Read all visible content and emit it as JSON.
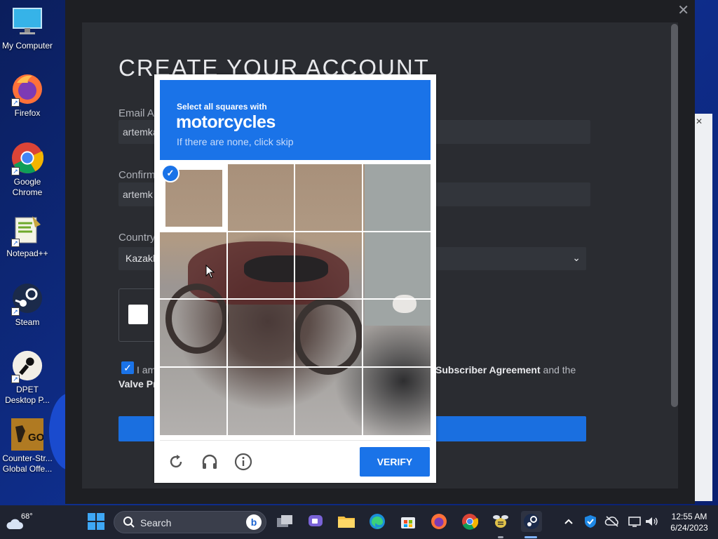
{
  "desktop": {
    "icons": [
      {
        "label": "My Computer",
        "icon": "monitor-icon"
      },
      {
        "label": "Firefox",
        "icon": "firefox-icon"
      },
      {
        "label": "Google\nChrome",
        "icon": "chrome-icon"
      },
      {
        "label": "Notepad++",
        "icon": "notepadpp-icon"
      },
      {
        "label": "Steam",
        "icon": "steam-icon"
      },
      {
        "label": "DPET\nDesktop P...",
        "icon": "dpet-icon"
      },
      {
        "label": "Counter-Str...\nGlobal Offe...",
        "icon": "csgo-icon"
      }
    ]
  },
  "steam_form": {
    "title": "CREATE YOUR ACCOUNT",
    "email_label": "Email Ac",
    "email_value": "artemka",
    "confirm_label": "Confirm",
    "confirm_value": "artemk",
    "country_label": "Country",
    "country_value": "Kazakh",
    "agree_prefix": "I am",
    "agree_mid_bold": "Subscriber Agreement",
    "agree_mid_suffix": " and the",
    "agree_prefix_cut": "n ",
    "agree_line2": "Valve Pr"
  },
  "hcaptcha": {
    "instruction_small": "Select all squares with",
    "target": "motorcycles",
    "hint": "If there are none, click skip",
    "verify_label": "VERIFY",
    "selected_cells": [
      0
    ],
    "grid_size": 4
  },
  "taskbar": {
    "weather_temp": "68°",
    "search_label": "Search",
    "time": "12:55 AM",
    "date": "6/24/2023"
  },
  "colors": {
    "accent": "#1a73e8",
    "steam_bg": "#2a2c31",
    "taskbar_bg": "#1f2330"
  }
}
